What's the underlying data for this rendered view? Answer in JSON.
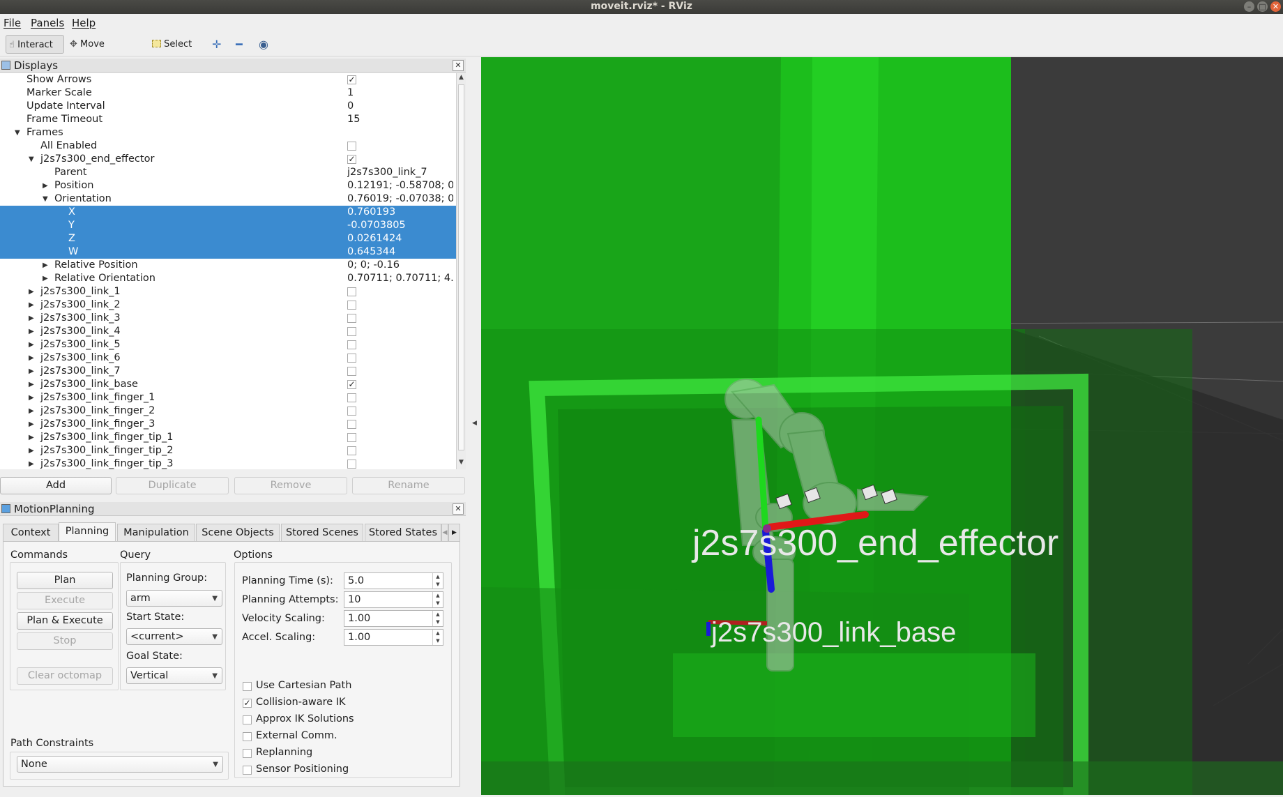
{
  "window": {
    "title": "moveit.rviz* - RViz"
  },
  "menu": {
    "file": "File",
    "panels": "Panels",
    "help": "Help"
  },
  "toolbar": {
    "interact": "Interact",
    "move_camera": "Move Camera",
    "select": "Select"
  },
  "displays": {
    "title": "Displays",
    "rows": [
      {
        "label": "Show Arrows",
        "value": "",
        "check": "on",
        "indent": 38,
        "arrow": ""
      },
      {
        "label": "Marker Scale",
        "value": "1",
        "check": "",
        "indent": 38,
        "arrow": ""
      },
      {
        "label": "Update Interval",
        "value": "0",
        "check": "",
        "indent": 38,
        "arrow": ""
      },
      {
        "label": "Frame Timeout",
        "value": "15",
        "check": "",
        "indent": 38,
        "arrow": ""
      },
      {
        "label": "Frames",
        "value": "",
        "check": "",
        "indent": 38,
        "arrow": "down"
      },
      {
        "label": "All Enabled",
        "value": "",
        "check": "off",
        "indent": 58,
        "arrow": ""
      },
      {
        "label": "j2s7s300_end_effector",
        "value": "",
        "check": "on",
        "indent": 58,
        "arrow": "down"
      },
      {
        "label": "Parent",
        "value": "j2s7s300_link_7",
        "check": "",
        "indent": 78,
        "arrow": ""
      },
      {
        "label": "Position",
        "value": "0.12191; -0.58708; 0...",
        "check": "",
        "indent": 78,
        "arrow": "right"
      },
      {
        "label": "Orientation",
        "value": "0.76019; -0.07038; 0...",
        "check": "",
        "indent": 78,
        "arrow": "down"
      },
      {
        "label": "X",
        "value": "0.760193",
        "check": "",
        "indent": 98,
        "arrow": "",
        "selected": true
      },
      {
        "label": "Y",
        "value": "-0.0703805",
        "check": "",
        "indent": 98,
        "arrow": "",
        "selected": true
      },
      {
        "label": "Z",
        "value": "0.0261424",
        "check": "",
        "indent": 98,
        "arrow": "",
        "selected": true
      },
      {
        "label": "W",
        "value": "0.645344",
        "check": "",
        "indent": 98,
        "arrow": "",
        "selected": true
      },
      {
        "label": "Relative Position",
        "value": "0; 0; -0.16",
        "check": "",
        "indent": 78,
        "arrow": "right"
      },
      {
        "label": "Relative Orientation",
        "value": "0.70711; 0.70711; 4....",
        "check": "",
        "indent": 78,
        "arrow": "right"
      },
      {
        "label": "j2s7s300_link_1",
        "value": "",
        "check": "off",
        "indent": 58,
        "arrow": "right"
      },
      {
        "label": "j2s7s300_link_2",
        "value": "",
        "check": "off",
        "indent": 58,
        "arrow": "right"
      },
      {
        "label": "j2s7s300_link_3",
        "value": "",
        "check": "off",
        "indent": 58,
        "arrow": "right"
      },
      {
        "label": "j2s7s300_link_4",
        "value": "",
        "check": "off",
        "indent": 58,
        "arrow": "right"
      },
      {
        "label": "j2s7s300_link_5",
        "value": "",
        "check": "off",
        "indent": 58,
        "arrow": "right"
      },
      {
        "label": "j2s7s300_link_6",
        "value": "",
        "check": "off",
        "indent": 58,
        "arrow": "right"
      },
      {
        "label": "j2s7s300_link_7",
        "value": "",
        "check": "off",
        "indent": 58,
        "arrow": "right"
      },
      {
        "label": "j2s7s300_link_base",
        "value": "",
        "check": "on",
        "indent": 58,
        "arrow": "right"
      },
      {
        "label": "j2s7s300_link_finger_1",
        "value": "",
        "check": "off",
        "indent": 58,
        "arrow": "right"
      },
      {
        "label": "j2s7s300_link_finger_2",
        "value": "",
        "check": "off",
        "indent": 58,
        "arrow": "right"
      },
      {
        "label": "j2s7s300_link_finger_3",
        "value": "",
        "check": "off",
        "indent": 58,
        "arrow": "right"
      },
      {
        "label": "j2s7s300_link_finger_tip_1",
        "value": "",
        "check": "off",
        "indent": 58,
        "arrow": "right"
      },
      {
        "label": "j2s7s300_link_finger_tip_2",
        "value": "",
        "check": "off",
        "indent": 58,
        "arrow": "right"
      },
      {
        "label": "j2s7s300_link_finger_tip_3",
        "value": "",
        "check": "off",
        "indent": 58,
        "arrow": "right"
      }
    ],
    "buttons": {
      "add": "Add",
      "duplicate": "Duplicate",
      "remove": "Remove",
      "rename": "Rename"
    }
  },
  "motion": {
    "title": "MotionPlanning",
    "tabs": [
      "Context",
      "Planning",
      "Manipulation",
      "Scene Objects",
      "Stored Scenes",
      "Stored States"
    ],
    "active_tab": "Planning",
    "commands": {
      "title": "Commands",
      "plan": "Plan",
      "execute": "Execute",
      "plan_execute": "Plan & Execute",
      "stop": "Stop",
      "clear_octomap": "Clear octomap"
    },
    "query": {
      "title": "Query",
      "planning_group_label": "Planning Group:",
      "planning_group": "arm",
      "start_state_label": "Start State:",
      "start_state": "<current>",
      "goal_state_label": "Goal State:",
      "goal_state": "Vertical"
    },
    "options": {
      "title": "Options",
      "planning_time_label": "Planning Time (s):",
      "planning_time": "5.0",
      "planning_attempts_label": "Planning Attempts:",
      "planning_attempts": "10",
      "velocity_scaling_label": "Velocity Scaling:",
      "velocity_scaling": "1.00",
      "accel_scaling_label": "Accel. Scaling:",
      "accel_scaling": "1.00",
      "checks": [
        {
          "label": "Use Cartesian Path",
          "checked": false
        },
        {
          "label": "Collision-aware IK",
          "checked": true
        },
        {
          "label": "Approx IK Solutions",
          "checked": false
        },
        {
          "label": "External Comm.",
          "checked": false
        },
        {
          "label": "Replanning",
          "checked": false
        },
        {
          "label": "Sensor Positioning",
          "checked": false
        }
      ]
    },
    "path_constraints": {
      "title": "Path Constraints",
      "value": "None"
    }
  },
  "view": {
    "labels": {
      "end_effector": "j2s7s300_end_effector",
      "link_base": "j2s7s300_link_base"
    },
    "colors": {
      "scene_green": "#1fc21f",
      "background": "#3a3a3a",
      "x_axis": "#e01818",
      "y_axis": "#1ed81e",
      "z_axis": "#1a1ad8"
    }
  }
}
